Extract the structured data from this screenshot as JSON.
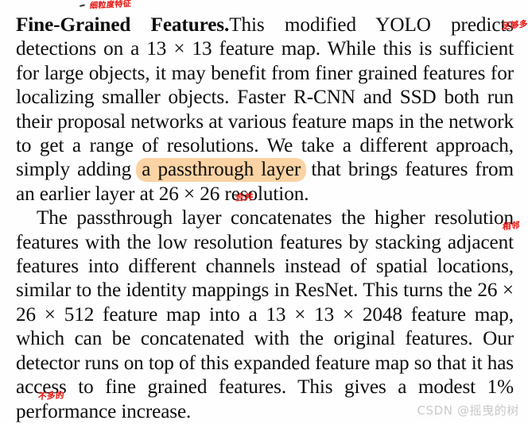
{
  "document": {
    "type": "paper-excerpt",
    "background_color": "#fefefe",
    "text_color": "#0d0d0c",
    "paragraphs": [
      {
        "id": "fine-grained-features",
        "run_in_heading": "Fine-Grained Features.",
        "segments": {
          "before_highlight": "This modified YOLO predicts detections on a 13 × 13 feature map. While this is sufficient for large objects, it may benefit from finer grained features for localizing smaller objects. Faster R-CNN and SSD both run their proposal networks at various feature maps in the network to get a range of resolutions. We take a different approach, simply adding",
          "highlighted": "a passthrough layer",
          "after_highlight": "that brings features from an earlier layer at 26 × 26 resolution."
        },
        "full_text": "Fine-Grained Features.This modified YOLO predicts detections on a 13 × 13 feature map. While this is sufficient for large objects, it may benefit from finer grained features for localizing smaller objects. Faster R-CNN and SSD both run their proposal networks at various feature maps in the network to get a range of resolutions. We take a different approach, simply adding a passthrough layer that brings features from an earlier layer at 26 × 26 resolution."
      },
      {
        "id": "passthrough-detail",
        "text_head": "The passthrough layer concatenates the higher resolution features with the low resolution features by stacking adjacent features into different channels instead of spatial locations, similar to the identity mappings in ResNet. This turns the 26 × 26 × 512 feature map into a 13 × 13 × 2048 feature map, which can be concatenated with the original features. Our detector runs on top of this expanded feature map so that it has access to fine grained features. This gives",
        "text_last_line": "a modest 1% performance increase."
      }
    ],
    "highlight": {
      "text": "a passthrough layer",
      "color": "#fbd3a4",
      "shape": "rounded-pill"
    },
    "annotations": [
      {
        "id": "fine-grained",
        "text": "细粒度特征",
        "color": "#e8231e",
        "target": "Fine-Grained"
      },
      {
        "id": "sufficient",
        "text": "足够多",
        "color": "#e8231e",
        "target": "suffi-cient"
      },
      {
        "id": "concatenates",
        "text": "合并",
        "color": "#e8231e",
        "target": "concatenates"
      },
      {
        "id": "adjacent",
        "text": "相邻",
        "color": "#e8231e",
        "target": "adja-cent"
      },
      {
        "id": "modest",
        "text": "不多的",
        "color": "#e8231e",
        "target": "modest"
      }
    ],
    "watermark": {
      "text": "CSDN @摇曳的树",
      "color": "#c9c9c9"
    }
  }
}
